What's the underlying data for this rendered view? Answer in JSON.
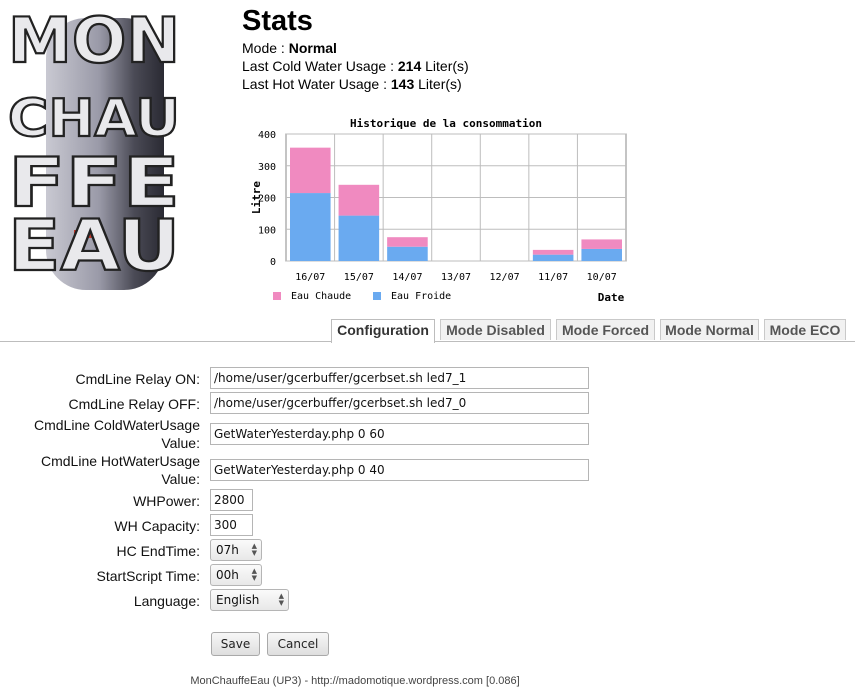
{
  "logo": {
    "text": "MONCHAUFFEEAU",
    "lines": [
      "MON",
      "CHAU",
      "FFE",
      "EAU"
    ]
  },
  "stats": {
    "title": "Stats",
    "mode_label": "Mode : ",
    "mode_value": "Normal",
    "cold_label": "Last Cold Water Usage : ",
    "cold_value": "214",
    "cold_unit": " Liter(s)",
    "hot_label": "Last Hot Water Usage : ",
    "hot_value": "143",
    "hot_unit": " Liter(s)"
  },
  "chart_data": {
    "type": "bar",
    "stacked": true,
    "title": "Historique de la consommation",
    "xlabel": "Date",
    "ylabel": "Litre",
    "ylim": [
      0,
      400
    ],
    "yticks": [
      0,
      100,
      200,
      300,
      400
    ],
    "categories": [
      "16/07",
      "15/07",
      "14/07",
      "13/07",
      "12/07",
      "11/07",
      "10/07"
    ],
    "series": [
      {
        "name": "Eau Froide",
        "color": "#6aaaf0",
        "values": [
          214,
          143,
          45,
          0,
          0,
          20,
          38
        ]
      },
      {
        "name": "Eau Chaude",
        "color": "#f08ac0",
        "values": [
          143,
          97,
          30,
          0,
          0,
          15,
          30
        ]
      }
    ],
    "grid": true,
    "legend": "bottom-left"
  },
  "tabs": [
    {
      "label": "Configuration",
      "active": true
    },
    {
      "label": "Mode Disabled",
      "active": false
    },
    {
      "label": "Mode Forced",
      "active": false
    },
    {
      "label": "Mode Normal",
      "active": false
    },
    {
      "label": "Mode ECO",
      "active": false
    }
  ],
  "form": {
    "relay_on_label": "CmdLine Relay ON:",
    "relay_on_value": "/home/user/gcerbuffer/gcerbset.sh led7_1",
    "relay_off_label": "CmdLine Relay OFF:",
    "relay_off_value": "/home/user/gcerbuffer/gcerbset.sh led7_0",
    "cold_usage_label_1": "CmdLine ColdWaterUsage",
    "cold_usage_label_2": "Value:",
    "cold_usage_value": "GetWaterYesterday.php 0 60",
    "hot_usage_label_1": "CmdLine HotWaterUsage",
    "hot_usage_label_2": "Value:",
    "hot_usage_value": "GetWaterYesterday.php 0 40",
    "whpower_label": "WHPower:",
    "whpower_value": "2800",
    "whcapacity_label": "WH Capacity:",
    "whcapacity_value": "300",
    "hc_endtime_label": "HC EndTime:",
    "hc_endtime_value": "07h",
    "startscript_label": "StartScript Time:",
    "startscript_value": "00h",
    "language_label": "Language:",
    "language_value": "English",
    "save_label": "Save",
    "cancel_label": "Cancel"
  },
  "footer": {
    "text": "MonChauffeEau (UP3) - http://madomotique.wordpress.com [0.086]"
  }
}
